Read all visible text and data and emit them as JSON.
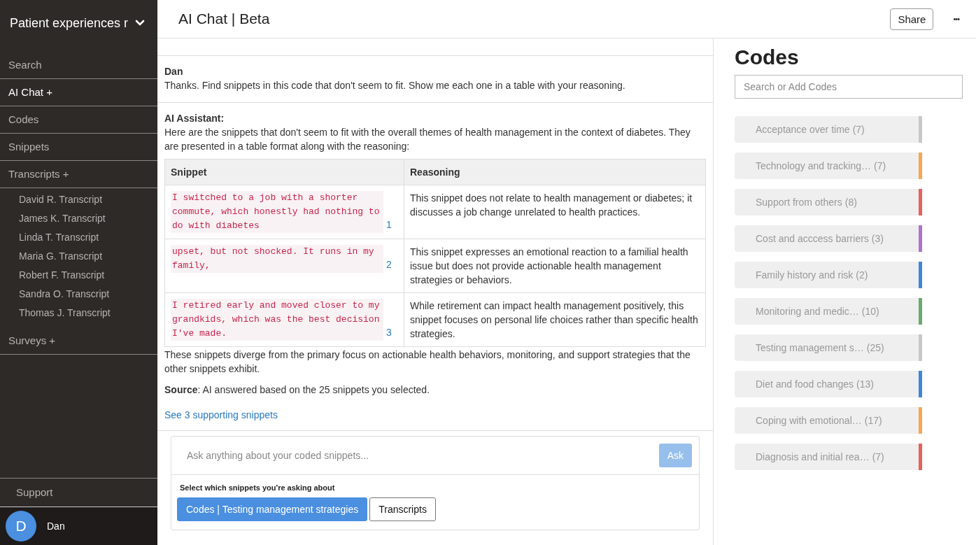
{
  "sidebar": {
    "project": "Patient experiences r",
    "nav": [
      {
        "label": "Search",
        "selected": false
      },
      {
        "label": "AI Chat +",
        "selected": true
      },
      {
        "label": "Codes",
        "selected": false
      },
      {
        "label": "Snippets",
        "selected": false
      },
      {
        "label": "Transcripts +",
        "selected": false,
        "children": [
          {
            "label": "David R. Transcript"
          },
          {
            "label": "James K. Transcript"
          },
          {
            "label": "Linda T. Transcript"
          },
          {
            "label": "Maria G. Transcript"
          },
          {
            "label": "Robert F. Transcript"
          },
          {
            "label": "Sandra O. Transcript"
          },
          {
            "label": "Thomas J. Transcript"
          }
        ]
      },
      {
        "label": "Surveys +",
        "selected": false
      }
    ],
    "support": "Support",
    "user": {
      "initial": "D",
      "name": "Dan"
    }
  },
  "header": {
    "title": "AI Chat | Beta",
    "share": "Share",
    "more": "•••"
  },
  "messages": [
    {
      "kind": "user",
      "author": "Dan",
      "text": "Thanks. Find snippets in this code that don't seem to fit. Show me each one in a table with your reasoning."
    },
    {
      "kind": "assistant",
      "author": "AI Assistant:",
      "intro": "Here are the snippets that don't seem to fit with the overall themes of health management in the context of diabetes. They are presented in a table format along with the reasoning:",
      "table": {
        "columns": [
          "Snippet",
          "Reasoning"
        ],
        "rows": [
          {
            "snippet": "I switched to a job with a shorter commute, which honestly had nothing to do with diabetes",
            "ref": "1",
            "reasoning": "This snippet does not relate to health management or diabetes; it discusses a job change unrelated to health practices."
          },
          {
            "snippet": "upset, but not shocked. It runs in my family,",
            "ref": "2",
            "reasoning": "This snippet expresses an emotional reaction to a familial health issue but does not provide actionable health management strategies or behaviors."
          },
          {
            "snippet": "I retired early and moved closer to my grandkids, which was the best decision I've made.",
            "ref": "3",
            "reasoning": "While retirement can impact health management positively, this snippet focuses on personal life choices rather than specific health strategies."
          }
        ]
      },
      "outro": "These snippets diverge from the primary focus on actionable health behaviors, monitoring, and support strategies that the other snippets exhibit.",
      "source": "**Source**: AI answered based on the 25 snippets you selected.",
      "link": "See 3 supporting snippets"
    }
  ],
  "composer": {
    "placeholder": "Ask anything about your coded snippets...",
    "ask": "Ask",
    "ask_disabled": true,
    "scope_label": "Select which snippets you're asking about",
    "scopes": [
      {
        "label": "Codes | Testing management strategies",
        "selected": true
      },
      {
        "label": "Transcripts",
        "selected": false
      }
    ]
  },
  "codes": {
    "title": "Codes",
    "placeholder": "Search or Add Codes",
    "items": [
      {
        "label": "Acceptance over time",
        "count": "(7)",
        "color": "#c8c8c8"
      },
      {
        "label": "Technology and tracking…",
        "count": "(7)",
        "color": "#f4a750"
      },
      {
        "label": "Support from others",
        "count": "(8)",
        "color": "#e8605c"
      },
      {
        "label": "Cost and acccess barriers",
        "count": "(3)",
        "color": "#b072c8"
      },
      {
        "label": "Family history and risk",
        "count": "(2)",
        "color": "#3f86d8"
      },
      {
        "label": "Monitoring and medic…",
        "count": "(10)",
        "color": "#6aaa6a"
      },
      {
        "label": "Testing management s…",
        "count": "(25)",
        "color": "#c8c8c8"
      },
      {
        "label": "Diet and food changes",
        "count": "(13)",
        "color": "#3f86d8"
      },
      {
        "label": "Coping with emotional…",
        "count": "(17)",
        "color": "#f4a750"
      },
      {
        "label": "Diagnosis and initial rea…",
        "count": "(7)",
        "color": "#e8605c"
      }
    ]
  }
}
